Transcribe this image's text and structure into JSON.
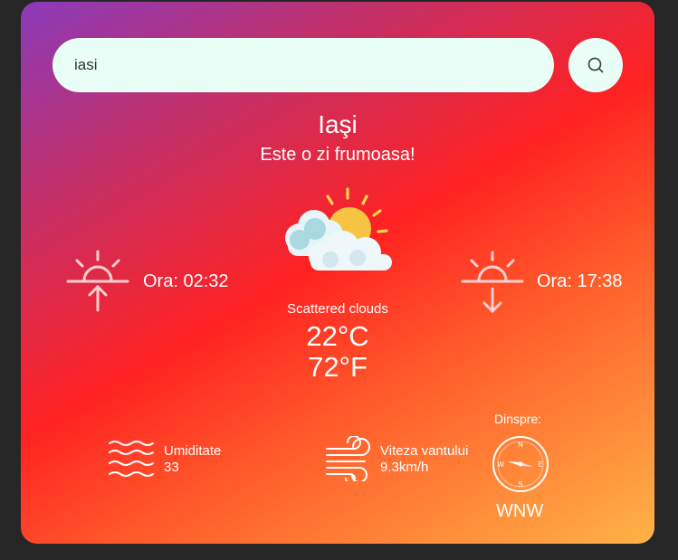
{
  "search": {
    "value": "iasi",
    "placeholder": ""
  },
  "location": {
    "city": "Iaşi",
    "tagline": "Este o zi frumoasa!"
  },
  "sun": {
    "sunrise": "Ora: 02:32",
    "sunset": "Ora: 17:38"
  },
  "weather": {
    "description": "Scattered clouds",
    "temp_c": "22°C",
    "temp_f": "72°F"
  },
  "humidity": {
    "label": "Umiditate",
    "value": "33"
  },
  "wind": {
    "label": "Viteza vantului",
    "value": "9.3km/h"
  },
  "direction": {
    "label": "Dinspre:",
    "value": "WNW",
    "compass_letters": {
      "n": "N",
      "e": "E",
      "s": "S",
      "w": "W"
    }
  },
  "icons": [
    "search-icon",
    "partly-cloudy-icon",
    "sunrise-icon",
    "sunset-icon",
    "humidity-icon",
    "wind-icon",
    "compass-icon"
  ],
  "colors": {
    "card_gradient": [
      "#8b3aba",
      "#ff2222",
      "#ffb347"
    ],
    "search_bg": "#eafef8",
    "page_bg": "#262626"
  }
}
